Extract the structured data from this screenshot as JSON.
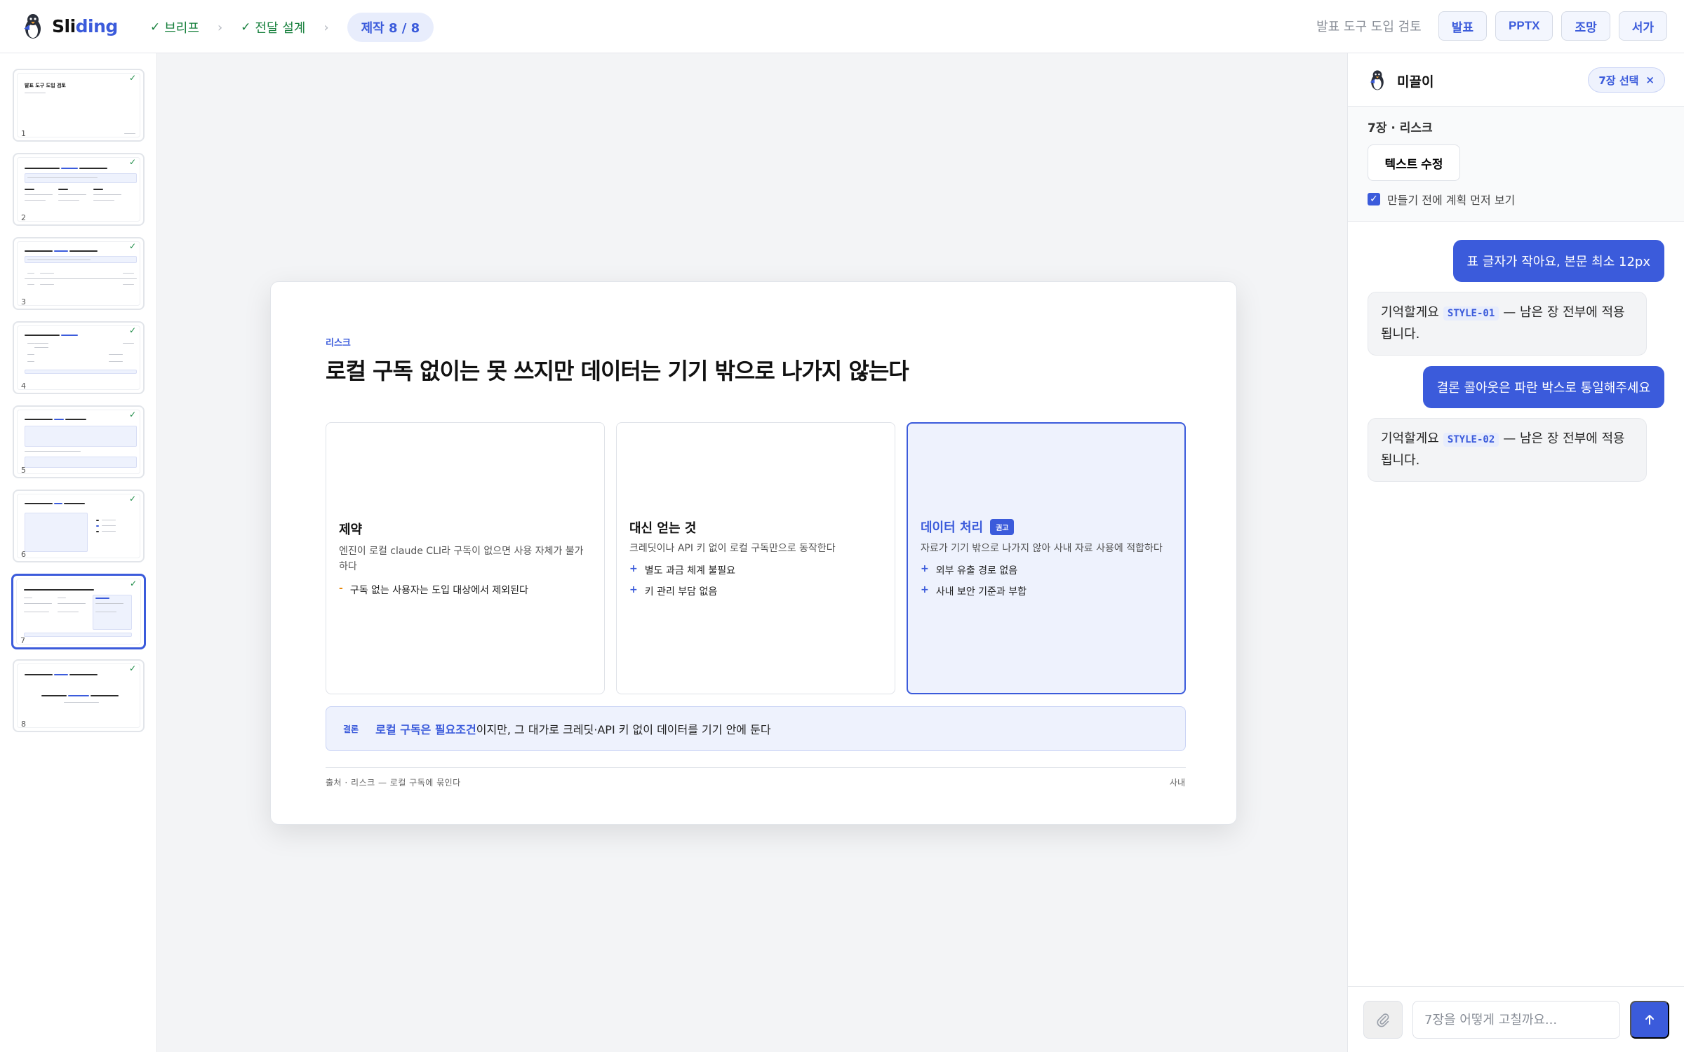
{
  "app": {
    "name_a": "Sli",
    "name_b": "ding"
  },
  "steps": {
    "brief": "브리프",
    "design": "전달 설계",
    "current": "제작 8 / 8"
  },
  "header": {
    "doc_title": "발표 도구 도입 검토",
    "modes": [
      "발표",
      "PPTX",
      "조망",
      "서가"
    ]
  },
  "thumbnails": {
    "count": 8,
    "active": 7,
    "items": [
      {
        "num": "1",
        "title": "발표 도구 도입 검토"
      },
      {
        "num": "2"
      },
      {
        "num": "3"
      },
      {
        "num": "4"
      },
      {
        "num": "5"
      },
      {
        "num": "6"
      },
      {
        "num": "7"
      },
      {
        "num": "8"
      }
    ]
  },
  "slide": {
    "eyebrow": "리스크",
    "title": "로컬 구독 없이는 못 쓰지만 데이터는 기기 밖으로 나가지 않는다",
    "cards": [
      {
        "heading": "제약",
        "desc": "엔진이 로컬 claude CLI라 구독이 없으면 사용 자체가 불가하다",
        "bullets": [
          "구독 없는 사용자는 도입 대상에서 제외된다"
        ]
      },
      {
        "heading": "대신 얻는 것",
        "desc": "크레딧이나 API 키 없이 로컬 구독만으로 동작한다",
        "bullets": [
          "별도 과금 체계 불필요",
          "키 관리 부담 없음"
        ]
      },
      {
        "heading": "데이터 처리",
        "badge": "권고",
        "desc": "자료가 기기 밖으로 나가지 않아 사내 자료 사용에 적합하다",
        "bullets": [
          "외부 유출 경로 없음",
          "사내 보안 기준과 부합"
        ]
      }
    ],
    "conclusion": {
      "label": "결론",
      "emphasis": "로컬 구독은 필요조건",
      "rest": "이지만, 그 대가로 크레딧·API 키 없이 데이터를 기기 안에 둔다"
    },
    "footer_left": "출처 · 리스크 — 로컬 구독에 묶인다",
    "footer_right": "사내"
  },
  "panel": {
    "assistant_name": "미끌이",
    "selection_chip": "7장 선택",
    "context_title": "7장 · 리스크",
    "edit_button": "텍스트 수정",
    "plan_checkbox_label": "만들기 전에 계획 먼저 보기",
    "plan_checked": true,
    "messages": [
      {
        "role": "user",
        "text": "표 글자가 작아요, 본문 최소 12px"
      },
      {
        "role": "assistant",
        "pre": "기억할게요",
        "code": "STYLE-01",
        "post": "— 남은 장 전부에 적용됩니다."
      },
      {
        "role": "user",
        "text": "결론 콜아웃은 파란 박스로 통일해주세요"
      },
      {
        "role": "assistant",
        "pre": "기억할게요",
        "code": "STYLE-02",
        "post": "— 남은 장 전부에 적용됩니다."
      }
    ],
    "input_placeholder": "7장을 어떻게 고칠까요..."
  },
  "colors": {
    "accent": "#3b5bdb",
    "success": "#17803d",
    "warning": "#e8890c"
  }
}
